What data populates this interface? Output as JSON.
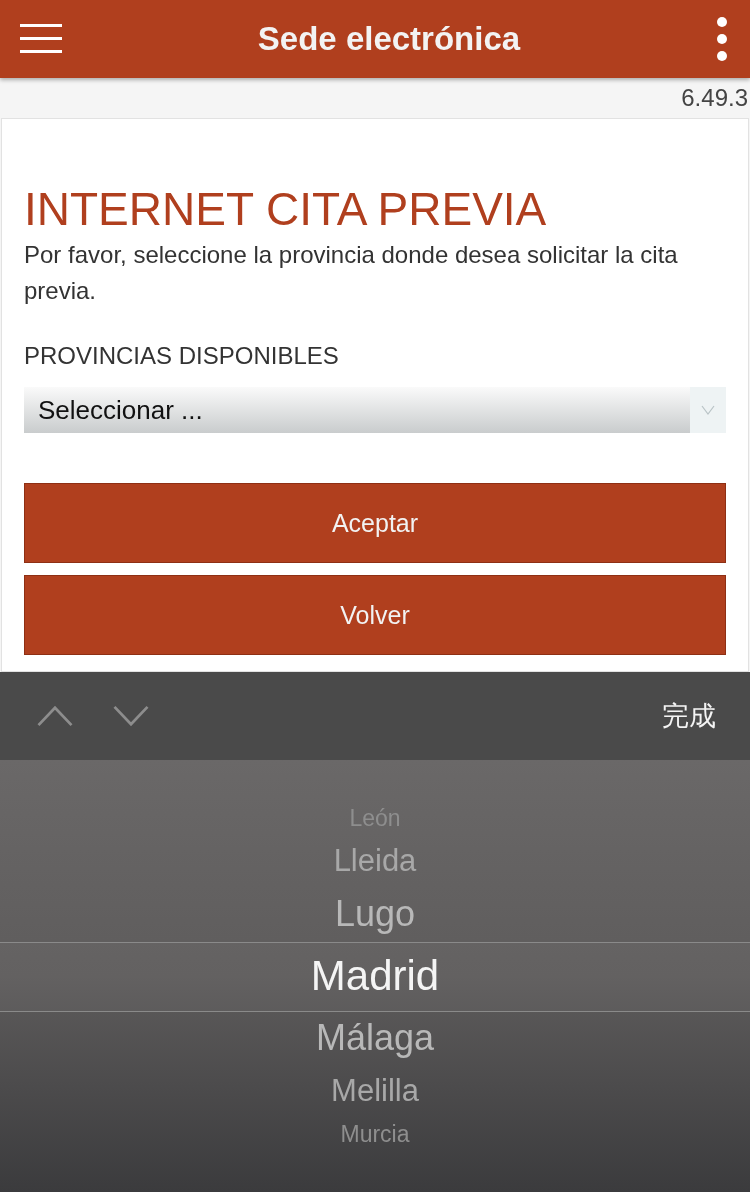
{
  "header": {
    "title": "Sede electrónica"
  },
  "version": "6.49.3",
  "page": {
    "heading": "INTERNET CITA PREVIA",
    "intro": "Por favor, seleccione la provincia donde desea solicitar la cita previa.",
    "select_label": "PROVINCIAS DISPONIBLES",
    "select_value": "Seleccionar ...",
    "buttons": [
      "Aceptar",
      "Volver"
    ]
  },
  "picker_toolbar": {
    "done": "完成"
  },
  "picker": [
    {
      "label": "León",
      "selected": false
    },
    {
      "label": "Lleida",
      "selected": false
    },
    {
      "label": "Lugo",
      "selected": false
    },
    {
      "label": "Madrid",
      "selected": true
    },
    {
      "label": "Málaga",
      "selected": false
    },
    {
      "label": "Melilla",
      "selected": false
    },
    {
      "label": "Murcia",
      "selected": false
    }
  ]
}
